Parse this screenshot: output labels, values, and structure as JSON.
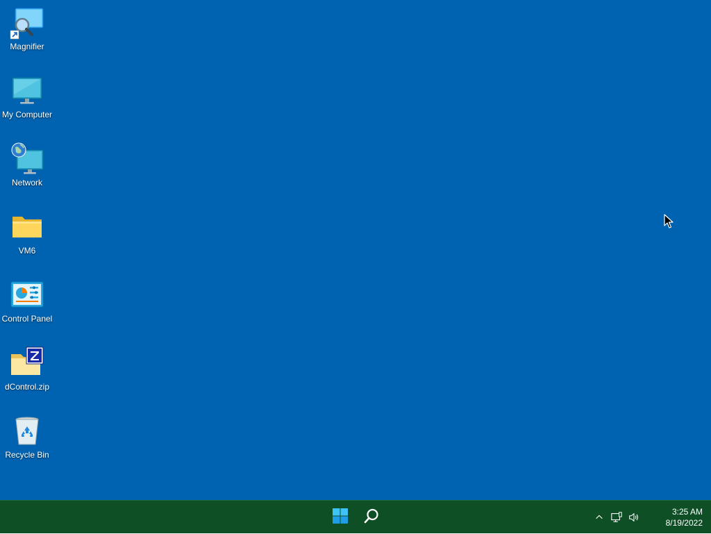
{
  "desktop": {
    "background_color": "#0063b1",
    "icons": [
      {
        "label": "Magnifier",
        "icon": "magnifier-icon"
      },
      {
        "label": "My Computer",
        "icon": "computer-icon"
      },
      {
        "label": "Network",
        "icon": "network-icon"
      },
      {
        "label": "VM6",
        "icon": "folder-icon"
      },
      {
        "label": "Control Panel",
        "icon": "control-panel-icon"
      },
      {
        "label": "dControl.zip",
        "icon": "zip-archive-icon"
      },
      {
        "label": "Recycle Bin",
        "icon": "recycle-bin-icon"
      }
    ]
  },
  "taskbar": {
    "background_color": "#0e4f25",
    "start_icon": "windows-logo-icon",
    "search_icon": "search-icon",
    "tray": {
      "icons": [
        "chevron-up-icon",
        "network-status-icon",
        "volume-icon"
      ],
      "time": "3:25 AM",
      "date": "8/19/2022"
    }
  }
}
